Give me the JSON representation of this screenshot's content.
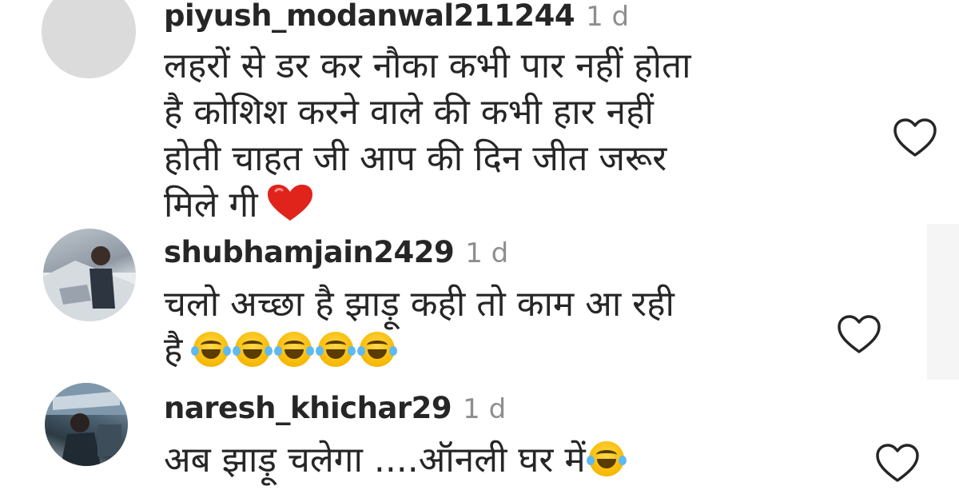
{
  "comments": [
    {
      "username": "piyush_modanwal211244",
      "time": "1 d",
      "lines": [
        "लहरों से डर कर नौका कभी पार नहीं होता",
        "है कोशिश करने वाले की कभी हार नहीं",
        "होती चाहत जी आप की दिन जीत जरूर",
        "मिले गी"
      ],
      "trailing_emoji": "heart-emoji",
      "avatar": "default-avatar"
    },
    {
      "username": "shubhamjain2429",
      "time": "1 d",
      "lines": [
        "चलो अच्छा है झाड़ू कही तो काम आ रही",
        "है"
      ],
      "trailing_emoji": "laughing-tears-emoji",
      "emoji_count": 5,
      "avatar": "user-photo"
    },
    {
      "username": "naresh_khichar29",
      "time": "1 d",
      "lines": [
        "अब झाड़ू चलेगा ....ऑनली घर में"
      ],
      "trailing_emoji": "laughing-tears-emoji",
      "emoji_count": 1,
      "avatar": "user-photo"
    }
  ],
  "colors": {
    "text": "#262626",
    "secondary": "#8e8e8e",
    "avatar_placeholder": "#dbdbdb",
    "heart_emoji": "#e0241b"
  },
  "icons": {
    "like": "heart-outline-icon"
  }
}
